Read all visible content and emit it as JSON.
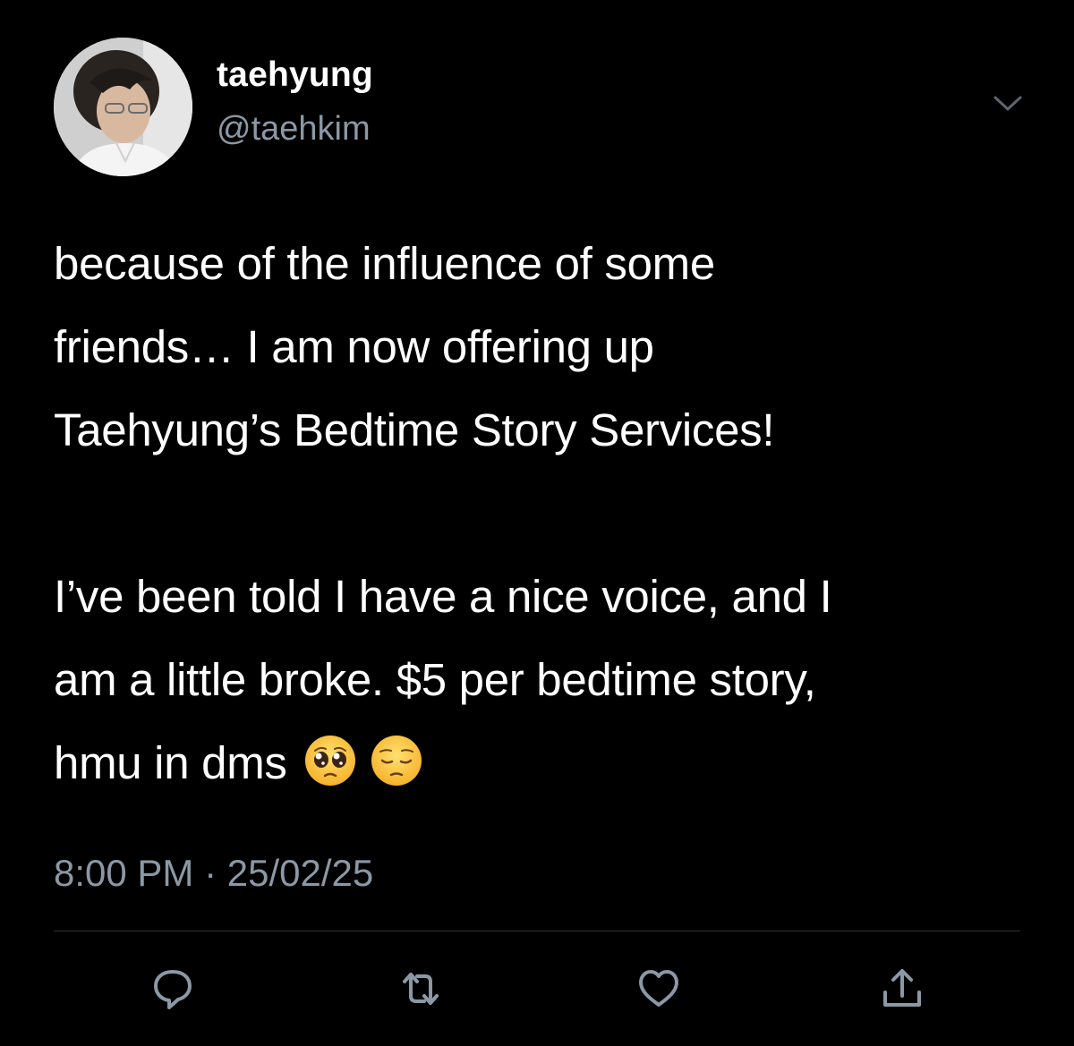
{
  "tweet": {
    "author": {
      "display_name": "taehyung",
      "handle": "@taehkim"
    },
    "body": {
      "paragraph1": [
        "because of the influence of some",
        "friends… I am now offering up",
        "Taehyung’s Bedtime Story Services!"
      ],
      "paragraph2": [
        "I’ve been told I have a nice voice, and I",
        "am a little broke. $5 per bedtime story,",
        "hmu in dms"
      ],
      "emojis": [
        "pleading-face-emoji",
        "pensive-face-emoji"
      ]
    },
    "timestamp": "8:00 PM · 25/02/25",
    "actions": [
      "reply-icon",
      "retweet-icon",
      "like-icon",
      "share-icon"
    ]
  },
  "colors": {
    "background": "#000000",
    "text": "#ffffff",
    "secondary": "#8b98a5",
    "divider": "#2f3336"
  }
}
